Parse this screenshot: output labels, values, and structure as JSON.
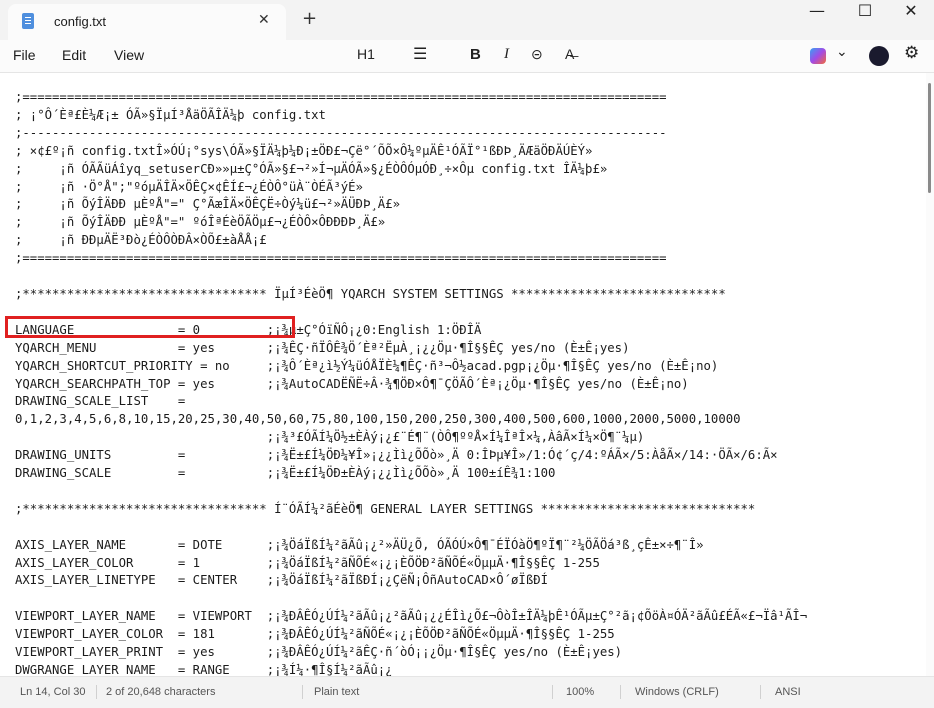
{
  "tab": {
    "title": "config.txt",
    "close": "✕",
    "new": "+"
  },
  "window": {
    "minimize": "—",
    "maximize": "☐",
    "close": "✕"
  },
  "menu": {
    "file": "File",
    "edit": "Edit",
    "view": "View"
  },
  "toolbar": {
    "heading": "H1",
    "list": "☰",
    "bold": "B",
    "italic": "I",
    "link": "⊝",
    "clear": "A̶",
    "chevron": "⌄",
    "settings": "⚙"
  },
  "editor": {
    "lines": [
      ";=======================================================================================",
      "; ¡°Ô´Èª£È¼Æ¡± ÓÃ»§ÏµÍ³ÅäÖÃÎÄ¼þ config.txt",
      ";---------------------------------------------------------------------------------------",
      "; ×¢£º¡ñ config.txtÎ»ÓÚ¡°sys\\ÓÃ»§ÏÄ¼þ¼Ð¡±ÖÐ£¬Çë°´ÕÕ×Ô¼ºµÄÊ¹ÓÃÏ°¹ßÐÞ¸ÄÆäÖÐÄÚÈÝ»",
      ";     ¡ñ ÓÃÃüÁîyq_setuserCÐ»»µ±Ç°ÓÃ»§£¬²»Í¬µÄÓÃ»§¿ÉÒÔÓµÓÐ¸÷×Ôµ config.txt ÎÄ¼þ£»",
      ";     ¡ñ ·Ö°Å\";\"ºóµÄÎÄ×ÖÊÇ×¢ÊÍ£¬¿ÉÒÔ°üÀ¨ÒÉÃ³ýÉ»",
      ";     ¡ñ ÕýÎÄÐÐ µÈºÅ\"=\" Ç°ÃæÎÄ×ÖÊÇË÷Òý¼ü£¬²»ÄÜÐÞ¸Ä£»",
      ";     ¡ñ ÕýÎÄÐÐ µÈºÅ\"=\" ºóÎªÉèÖÃÖµ£¬¿ÉÒÔ×ÔÐÐÐÞ¸Ä£»",
      ";     ¡ñ ÐÐµÄË³Ðò¿ÉÒÔÒÐÂ×ÒÕ£±àÅÅ¡£",
      ";=======================================================================================",
      "",
      ";********************************* ÏµÍ³ÉèÖ¶ YQARCH SYSTEM SETTINGS *****************************",
      "",
      "LANGUAGE              = 0         ;¡¾µ±Ç°ÓïÑÔ¡¿0:English 1:ÖÐÎÄ",
      "YQARCH_MENU           = yes       ;¡¾ÊÇ·ñÏÔÊ¾Ö´Èª²ËµÀ¸¡¿¿Öµ·¶Î§§ÊÇ yes/no (È±Ê¡yes)",
      "YQARCH_SHORTCUT_PRIORITY = no     ;¡¾Ô´Èª¿ì½Ý¼üÓÅÏÈ¼¶ÊÇ·ñ³¬Ô½acad.pgp¡¿Öµ·¶Î§ÊÇ yes/no (È±Ê¡no)",
      "YQARCH_SEARCHPATH_TOP = yes       ;¡¾AutoCADËÑË÷Â·¾¶ÖÐ×Ô¶¯ÇÖÃÔ´Èª¡¿Öµ·¶Î§ÊÇ yes/no (È±Ê¡no)",
      "DRAWING_SCALE_LIST    =",
      "0,1,2,3,4,5,6,8,10,15,20,25,30,40,50,60,75,80,100,150,200,250,300,400,500,600,1000,2000,5000,10000",
      "                                  ;¡¾³£ÓÃÍ¼Ö½±ÈÀý¡¿£¨É¶¨(ÒÔ¶ººÅ×Í¼ÎªÎ×¼,ÀâÃ×Í¼×Ö¶¨¼µ)",
      "DRAWING_UNITS         =           ;¡¾Ë±£Í¼ÖÐ¼¥Î»¡¿¿Ìì¿ÕÕò»¸Ä 0:ÎÞµ¥Î»/1:Ó¢´ç/4:ºÁÃ×/5:ÀåÃ×/14:·ÖÃ×/6:Ã×",
      "DRAWING_SCALE         =           ;¡¾Ë±£Í¼ÖÐ±ÈÀý¡¿¿Ìì¿ÕÕò»¸Ä 100±íÊ¾1:100",
      "",
      ";********************************* Í¨ÓÃÍ¼²ãÉèÖ¶ GENERAL LAYER SETTINGS *****************************",
      "",
      "AXIS_LAYER_NAME       = DOTE      ;¡¾ÖáÏßÍ¼²ãÃû¡¿²»ÄÜ¿Õ, ÓÃÓÚ×Ô¶¯ÉÏÓàÖ¶ºÏ¶¨²¼ÖÃÖá³ß¸çÊ±×÷¶¨Î»",
      "AXIS_LAYER_COLOR      = 1         ;¡¾ÖáÏßÍ¼²ãÑÕÉ«¡¿¡ÈÕÖÐ²ãÑÕÉ«ÖµµÄ·¶Î§§ÊÇ 1-255",
      "AXIS_LAYER_LINETYPE   = CENTER    ;¡¾ÖáÏßÍ¼²ãÏßÐÍ¡¿ÇëÑ¡ÔñAutoCAD×Ô´øÏßÐÍ",
      "",
      "VIEWPORT_LAYER_NAME   = VIEWPORT  ;¡¾ÐÂÊÓ¿ÚÍ¼²ãÃû¡¿²ãÃû¡¿¿ÉÎì¿Õ£¬ÔòÎ±ÎÄ¼þÊ¹ÓÃµ±Ç°²ã¡¢ÕöÀ¤ÓÄ²ãÃû£ÉÃ«£¬Ïâ¹ÃÎ¬",
      "VIEWPORT_LAYER_COLOR  = 181       ;¡¾ÐÂÊÓ¿ÚÍ¼²ãÑÕÉ«¡¿¡ÈÕÖÐ²ãÑÕÉ«ÖµµÄ·¶Î§§ÊÇ 1-255",
      "VIEWPORT_LAYER_PRINT  = yes       ;¡¾ÐÂÊÓ¿ÚÍ¼²ãÊÇ·ñ´òÓ¡¡¿Öµ·¶Î§ÊÇ yes/no (È±Ê¡yes)",
      "DWGRANGE_LAYER_NAME   = RANGE     ;¡¾Í¼·¶Î§Í¼²ãÃû¡¿"
    ]
  },
  "status": {
    "position": "Ln 14, Col 30",
    "chars": "2 of 20,648 characters",
    "format": "Plain text",
    "zoom": "100%",
    "eol": "Windows (CRLF)",
    "encoding": "ANSI"
  }
}
